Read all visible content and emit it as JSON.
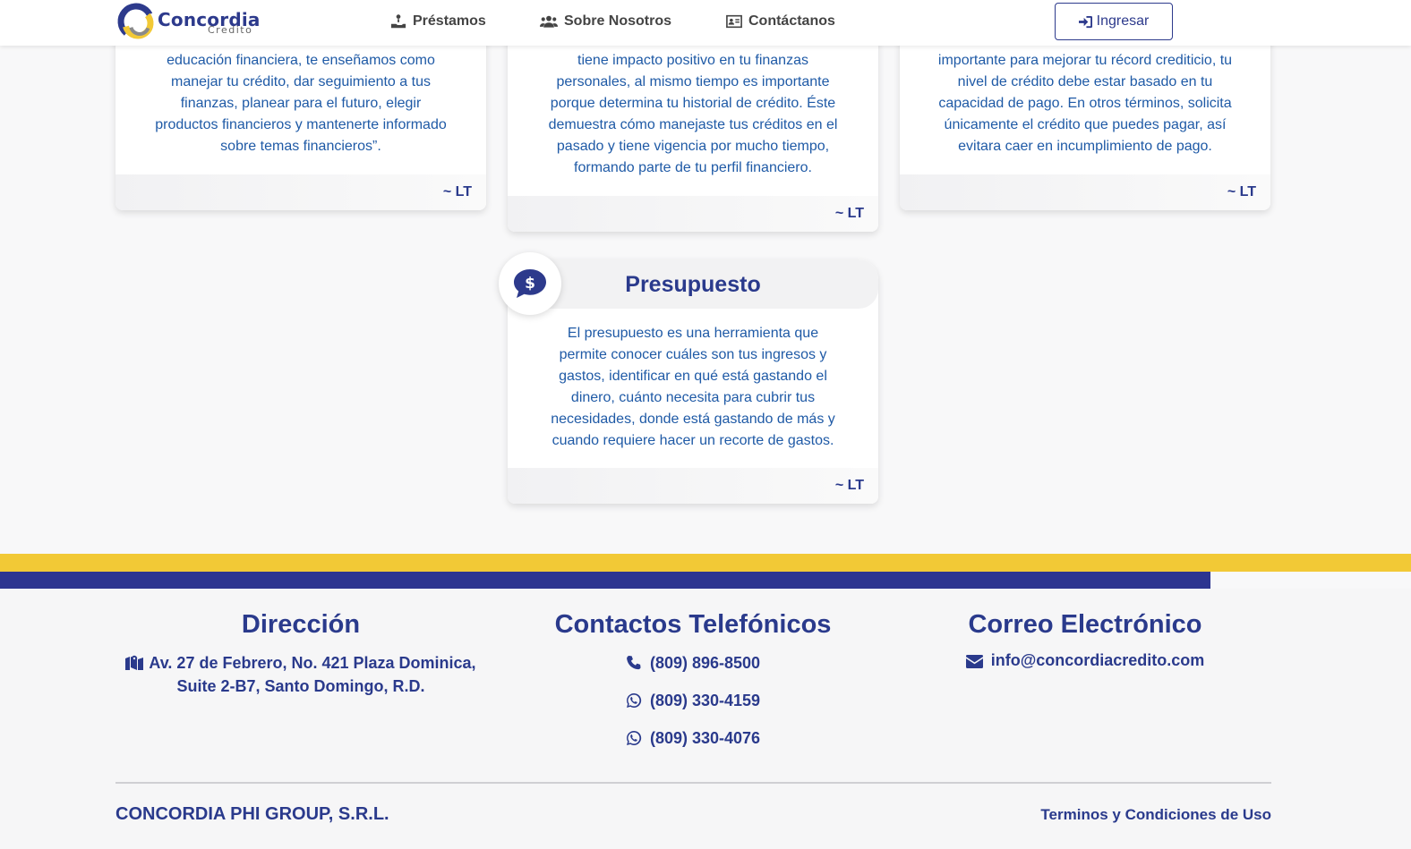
{
  "header": {
    "logo_name": "Concordia",
    "logo_sub": "Credito",
    "nav": [
      {
        "label": "Préstamos",
        "icon": "hand-coin-icon"
      },
      {
        "label": "Sobre Nosotros",
        "icon": "users-icon"
      },
      {
        "label": "Contáctanos",
        "icon": "address-card-icon"
      }
    ],
    "login_label": "Ingresar"
  },
  "cards": [
    {
      "lines": [
        "educación financiera, te enseñamos como",
        "manejar tu crédito, dar seguimiento a tus",
        "finanzas, planear para el futuro, elegir",
        "productos financieros y mantenerte informado",
        "sobre temas financieros”."
      ],
      "author": "~ LT"
    },
    {
      "lines": [
        "tiene impacto positivo en tu finanzas",
        "personales, al mismo tiempo es importante",
        "porque determina tu historial de crédito. Éste",
        "demuestra cómo manejaste tus créditos en el",
        "pasado y tiene vigencia por mucho tiempo,",
        "formando parte de tu perfil financiero."
      ],
      "author": "~ LT"
    },
    {
      "lines": [
        "importante para mejorar tu récord crediticio, tu",
        "nivel de crédito debe estar basado en tu",
        "capacidad de pago. En otros términos, solicita",
        "únicamente el crédito que puedes pagar, así",
        "evitara caer en incumplimiento de pago."
      ],
      "author": "~ LT"
    },
    {
      "title": "Presupuesto",
      "icon": "dollar-chat-icon",
      "lines": [
        "El presupuesto es una herramienta que",
        "permite conocer cuáles son tus ingresos y",
        "gastos, identificar en qué está gastando el",
        "dinero, cuánto necesita para cubrir tus",
        "necesidades, donde está gastando de más y",
        "cuando requiere hacer un recorte de gastos."
      ],
      "author": "~ LT"
    }
  ],
  "footer": {
    "address_title": "Dirección",
    "address_line1": "Av. 27 de Febrero, No. 421 Plaza Dominica,",
    "address_line2": "Suite 2-B7, Santo Domingo, R.D.",
    "phones_title": "Contactos Telefónicos",
    "phones": [
      "(809) 896-8500",
      "(809) 330-4159",
      "(809) 330-4076"
    ],
    "email_title": "Correo Electrónico",
    "email": "info@concordiacredito.com",
    "company": "CONCORDIA PHI GROUP, S.R.L.",
    "terms": "Terminos y Condiciones de Uso"
  },
  "colors": {
    "brand_blue": "#2d3a8c",
    "text_blue": "#1f5aa6",
    "accent_yellow": "#f2c936"
  }
}
